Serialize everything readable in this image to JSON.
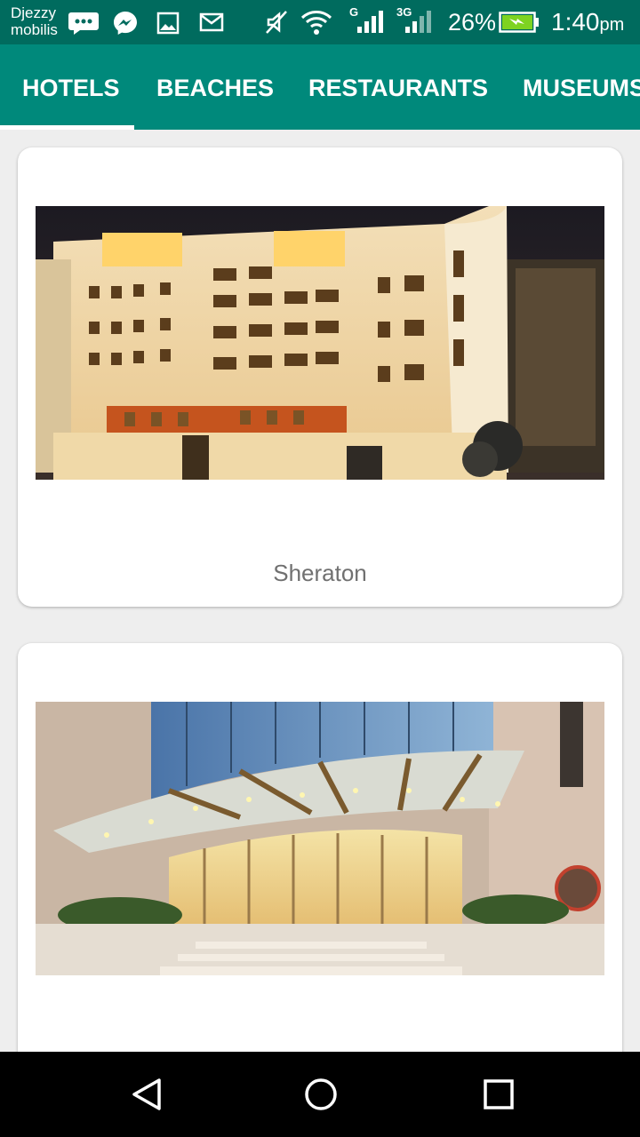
{
  "status_bar": {
    "carrier_line1": "Djezzy",
    "carrier_line2": "mobilis",
    "signal_label_1": "G",
    "signal_label_2": "3G",
    "battery_percent": "26%",
    "time": "1:40",
    "time_suffix": "pm",
    "icons": [
      "chat-bubble-icon",
      "messenger-icon",
      "gallery-icon",
      "mail-icon",
      "mute-icon",
      "wifi-icon",
      "signal-icon",
      "signal-3g-icon",
      "battery-charging-icon"
    ],
    "battery_level": 0.26
  },
  "tabs": [
    {
      "label": "HOTELS",
      "selected": true
    },
    {
      "label": "BEACHES",
      "selected": false
    },
    {
      "label": "RESTAURANTS",
      "selected": false
    },
    {
      "label": "MUSEUMS",
      "selected": false
    }
  ],
  "cards": [
    {
      "title": "Sheraton",
      "image": "hotel-night-facade-image"
    },
    {
      "title": "",
      "image": "hotel-entrance-canopy-image"
    }
  ],
  "nav_bar": {
    "icons": [
      "back-icon",
      "home-icon",
      "recents-icon"
    ]
  },
  "colors": {
    "status_bar": "#006b5e",
    "tab_bar": "#00897b",
    "background": "#eeeeee",
    "card": "#ffffff",
    "title_text": "#707070"
  }
}
